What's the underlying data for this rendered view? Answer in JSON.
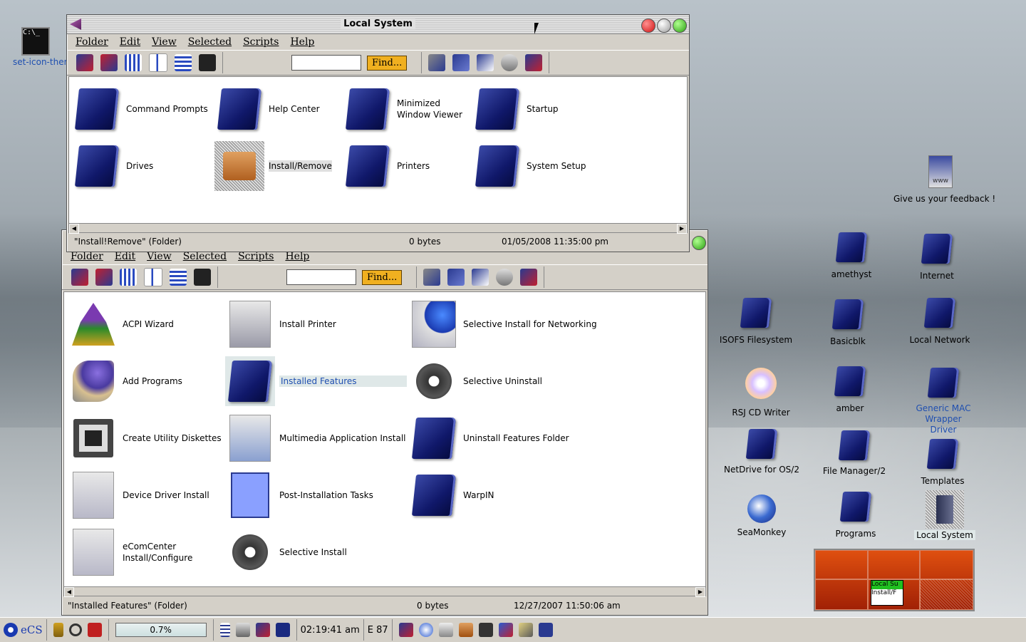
{
  "desktop_icons": [
    {
      "label": "set-icon-ther",
      "icon": "console-icon"
    },
    {
      "label": "Give us your feedback !",
      "icon": "www-icon"
    },
    {
      "label": "amethyst",
      "icon": "folder-icon"
    },
    {
      "label": "Internet",
      "icon": "globe-folder-icon"
    },
    {
      "label": "ISOFS Filesystem",
      "icon": "folder-icon"
    },
    {
      "label": "Basicblk",
      "icon": "folder-icon"
    },
    {
      "label": "Local Network",
      "icon": "network-folder-icon"
    },
    {
      "label": "RSJ CD Writer",
      "icon": "cd-writer-icon"
    },
    {
      "label": "amber",
      "icon": "folder-icon"
    },
    {
      "label": "Generic MAC Wrapper Driver",
      "icon": "mac-driver-icon"
    },
    {
      "label": "NetDrive for OS/2",
      "icon": "folder-icon"
    },
    {
      "label": "File Manager/2",
      "icon": "file-manager-icon"
    },
    {
      "label": "Templates",
      "icon": "templates-folder-icon"
    },
    {
      "label": "SeaMonkey",
      "icon": "seamonkey-icon"
    },
    {
      "label": "Programs",
      "icon": "programs-folder-icon"
    },
    {
      "label": "Local System",
      "icon": "computer-icon"
    }
  ],
  "window_top": {
    "title": "Local System",
    "menu": [
      "Folder",
      "Edit",
      "View",
      "Selected",
      "Scripts",
      "Help"
    ],
    "find_label": "Find...",
    "find_value": "",
    "items": [
      {
        "label": "Command Prompts",
        "icon": "command-prompt-folder-icon"
      },
      {
        "label": "Help Center",
        "icon": "help-folder-icon"
      },
      {
        "label": "Minimized Window Viewer",
        "icon": "minimized-viewer-icon"
      },
      {
        "label": "Startup",
        "icon": "traffic-light-folder-icon"
      },
      {
        "label": "Drives",
        "icon": "drives-folder-icon"
      },
      {
        "label": "Install/Remove",
        "icon": "install-remove-icon"
      },
      {
        "label": "Printers",
        "icon": "printer-folder-icon"
      },
      {
        "label": "System Setup",
        "icon": "system-setup-folder-icon"
      }
    ],
    "status": {
      "name": "\"Install!Remove\" (Folder)",
      "size": "0 bytes",
      "date": "01/05/2008 11:35:00 pm"
    }
  },
  "window_bottom": {
    "menu": [
      "Folder",
      "Edit",
      "View",
      "Selected",
      "Scripts",
      "Help"
    ],
    "find_label": "Find...",
    "find_value": "",
    "items": [
      {
        "label": "ACPI Wizard",
        "icon": "wizard-icon"
      },
      {
        "label": "Install Printer",
        "icon": "install-printer-icon"
      },
      {
        "label": "Selective Install for Networking",
        "icon": "network-install-icon"
      },
      {
        "label": "Add Programs",
        "icon": "add-programs-icon"
      },
      {
        "label": "Installed Features",
        "icon": "folder-icon"
      },
      {
        "label": "Selective Uninstall",
        "icon": "gear-uninstall-icon"
      },
      {
        "label": "Create Utility Diskettes",
        "icon": "diskettes-icon"
      },
      {
        "label": "Multimedia Application Install",
        "icon": "multimedia-install-icon"
      },
      {
        "label": "Uninstall Features Folder",
        "icon": "folder-icon"
      },
      {
        "label": "Device Driver Install",
        "icon": "driver-install-icon"
      },
      {
        "label": "Post-Installation Tasks",
        "icon": "notebook-icon"
      },
      {
        "label": "WarpIN",
        "icon": "folder-icon"
      },
      {
        "label": "eComCenter Install/Configure",
        "icon": "ecomcenter-install-icon"
      },
      {
        "label": "Selective Install",
        "icon": "gear-install-icon"
      }
    ],
    "status": {
      "name": "\"Installed Features\" (Folder)",
      "size": "0 bytes",
      "date": "12/27/2007 11:50:06 am"
    }
  },
  "taskbar": {
    "logo": "eCS",
    "cpu": "0.7%",
    "clock": "02:19:41 am",
    "drive_label": "E 87"
  },
  "pager": {
    "mini_title": "Local Su",
    "mini_sub": "Install/F"
  }
}
